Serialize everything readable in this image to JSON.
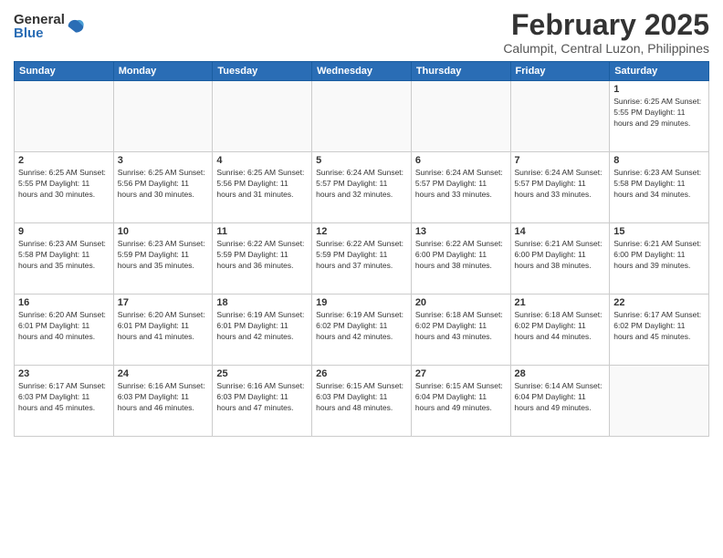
{
  "logo": {
    "general": "General",
    "blue": "Blue"
  },
  "header": {
    "month": "February 2025",
    "location": "Calumpit, Central Luzon, Philippines"
  },
  "weekdays": [
    "Sunday",
    "Monday",
    "Tuesday",
    "Wednesday",
    "Thursday",
    "Friday",
    "Saturday"
  ],
  "weeks": [
    [
      {
        "day": "",
        "info": ""
      },
      {
        "day": "",
        "info": ""
      },
      {
        "day": "",
        "info": ""
      },
      {
        "day": "",
        "info": ""
      },
      {
        "day": "",
        "info": ""
      },
      {
        "day": "",
        "info": ""
      },
      {
        "day": "1",
        "info": "Sunrise: 6:25 AM\nSunset: 5:55 PM\nDaylight: 11 hours and 29 minutes."
      }
    ],
    [
      {
        "day": "2",
        "info": "Sunrise: 6:25 AM\nSunset: 5:55 PM\nDaylight: 11 hours and 30 minutes."
      },
      {
        "day": "3",
        "info": "Sunrise: 6:25 AM\nSunset: 5:56 PM\nDaylight: 11 hours and 30 minutes."
      },
      {
        "day": "4",
        "info": "Sunrise: 6:25 AM\nSunset: 5:56 PM\nDaylight: 11 hours and 31 minutes."
      },
      {
        "day": "5",
        "info": "Sunrise: 6:24 AM\nSunset: 5:57 PM\nDaylight: 11 hours and 32 minutes."
      },
      {
        "day": "6",
        "info": "Sunrise: 6:24 AM\nSunset: 5:57 PM\nDaylight: 11 hours and 33 minutes."
      },
      {
        "day": "7",
        "info": "Sunrise: 6:24 AM\nSunset: 5:57 PM\nDaylight: 11 hours and 33 minutes."
      },
      {
        "day": "8",
        "info": "Sunrise: 6:23 AM\nSunset: 5:58 PM\nDaylight: 11 hours and 34 minutes."
      }
    ],
    [
      {
        "day": "9",
        "info": "Sunrise: 6:23 AM\nSunset: 5:58 PM\nDaylight: 11 hours and 35 minutes."
      },
      {
        "day": "10",
        "info": "Sunrise: 6:23 AM\nSunset: 5:59 PM\nDaylight: 11 hours and 35 minutes."
      },
      {
        "day": "11",
        "info": "Sunrise: 6:22 AM\nSunset: 5:59 PM\nDaylight: 11 hours and 36 minutes."
      },
      {
        "day": "12",
        "info": "Sunrise: 6:22 AM\nSunset: 5:59 PM\nDaylight: 11 hours and 37 minutes."
      },
      {
        "day": "13",
        "info": "Sunrise: 6:22 AM\nSunset: 6:00 PM\nDaylight: 11 hours and 38 minutes."
      },
      {
        "day": "14",
        "info": "Sunrise: 6:21 AM\nSunset: 6:00 PM\nDaylight: 11 hours and 38 minutes."
      },
      {
        "day": "15",
        "info": "Sunrise: 6:21 AM\nSunset: 6:00 PM\nDaylight: 11 hours and 39 minutes."
      }
    ],
    [
      {
        "day": "16",
        "info": "Sunrise: 6:20 AM\nSunset: 6:01 PM\nDaylight: 11 hours and 40 minutes."
      },
      {
        "day": "17",
        "info": "Sunrise: 6:20 AM\nSunset: 6:01 PM\nDaylight: 11 hours and 41 minutes."
      },
      {
        "day": "18",
        "info": "Sunrise: 6:19 AM\nSunset: 6:01 PM\nDaylight: 11 hours and 42 minutes."
      },
      {
        "day": "19",
        "info": "Sunrise: 6:19 AM\nSunset: 6:02 PM\nDaylight: 11 hours and 42 minutes."
      },
      {
        "day": "20",
        "info": "Sunrise: 6:18 AM\nSunset: 6:02 PM\nDaylight: 11 hours and 43 minutes."
      },
      {
        "day": "21",
        "info": "Sunrise: 6:18 AM\nSunset: 6:02 PM\nDaylight: 11 hours and 44 minutes."
      },
      {
        "day": "22",
        "info": "Sunrise: 6:17 AM\nSunset: 6:02 PM\nDaylight: 11 hours and 45 minutes."
      }
    ],
    [
      {
        "day": "23",
        "info": "Sunrise: 6:17 AM\nSunset: 6:03 PM\nDaylight: 11 hours and 45 minutes."
      },
      {
        "day": "24",
        "info": "Sunrise: 6:16 AM\nSunset: 6:03 PM\nDaylight: 11 hours and 46 minutes."
      },
      {
        "day": "25",
        "info": "Sunrise: 6:16 AM\nSunset: 6:03 PM\nDaylight: 11 hours and 47 minutes."
      },
      {
        "day": "26",
        "info": "Sunrise: 6:15 AM\nSunset: 6:03 PM\nDaylight: 11 hours and 48 minutes."
      },
      {
        "day": "27",
        "info": "Sunrise: 6:15 AM\nSunset: 6:04 PM\nDaylight: 11 hours and 49 minutes."
      },
      {
        "day": "28",
        "info": "Sunrise: 6:14 AM\nSunset: 6:04 PM\nDaylight: 11 hours and 49 minutes."
      },
      {
        "day": "",
        "info": ""
      }
    ]
  ]
}
